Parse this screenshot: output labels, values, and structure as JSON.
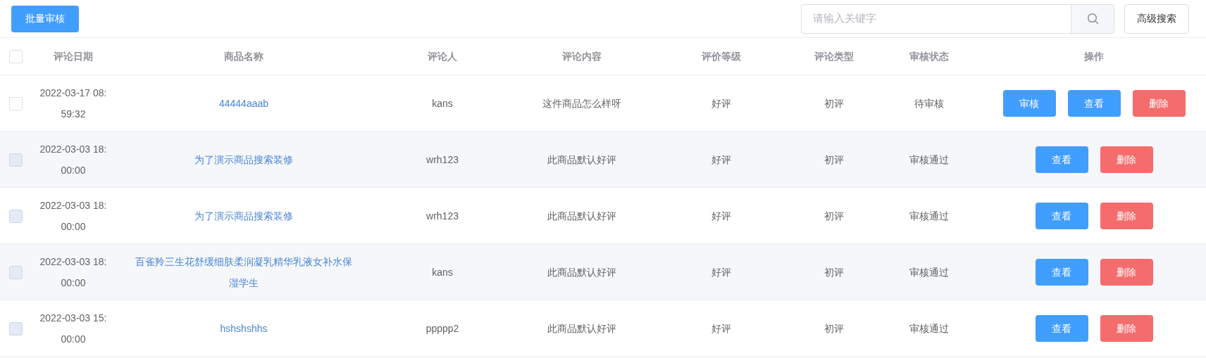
{
  "toolbar": {
    "batch_button": "批量审核",
    "search": {
      "placeholder": "请输入关键字"
    },
    "advanced_button": "高级搜索"
  },
  "table": {
    "select_all": {
      "checked": false
    },
    "columns": [
      "评论日期",
      "商品名称",
      "评论人",
      "评论内容",
      "评价等级",
      "评论类型",
      "审核状态",
      "操作"
    ],
    "rows": [
      {
        "checked": false,
        "disabled": false,
        "date": "2022-03-17 08:\n59:32",
        "product": "44444aaab",
        "commenter": "kans",
        "content": "这件商品怎么样呀",
        "rating": "好评",
        "type": "初评",
        "status": "待审核",
        "actions": [
          {
            "label": "审核",
            "kind": "primary"
          },
          {
            "label": "查看",
            "kind": "primary"
          },
          {
            "label": "删除",
            "kind": "danger"
          }
        ]
      },
      {
        "checked": false,
        "disabled": true,
        "date": "2022-03-03 18:\n00:00",
        "product": "为了演示商品搜索装修",
        "commenter": "wrh123",
        "content": "此商品默认好评",
        "rating": "好评",
        "type": "初评",
        "status": "审核通过",
        "actions": [
          {
            "label": "查看",
            "kind": "primary"
          },
          {
            "label": "删除",
            "kind": "danger"
          }
        ]
      },
      {
        "checked": false,
        "disabled": true,
        "date": "2022-03-03 18:\n00:00",
        "product": "为了演示商品搜索装修",
        "commenter": "wrh123",
        "content": "此商品默认好评",
        "rating": "好评",
        "type": "初评",
        "status": "审核通过",
        "actions": [
          {
            "label": "查看",
            "kind": "primary"
          },
          {
            "label": "删除",
            "kind": "danger"
          }
        ]
      },
      {
        "checked": false,
        "disabled": true,
        "date": "2022-03-03 18:\n00:00",
        "product": "百雀羚三生花舒缓细肤柔润凝乳精华乳液女补水保湿学生",
        "commenter": "kans",
        "content": "此商品默认好评",
        "rating": "好评",
        "type": "初评",
        "status": "审核通过",
        "actions": [
          {
            "label": "查看",
            "kind": "primary"
          },
          {
            "label": "删除",
            "kind": "danger"
          }
        ]
      },
      {
        "checked": false,
        "disabled": true,
        "date": "2022-03-03 15:\n00:00",
        "product": "hshshshhs",
        "commenter": "ppppp2",
        "content": "此商品默认好评",
        "rating": "好评",
        "type": "初评",
        "status": "审核通过",
        "actions": [
          {
            "label": "查看",
            "kind": "primary"
          },
          {
            "label": "删除",
            "kind": "danger"
          }
        ]
      }
    ]
  }
}
